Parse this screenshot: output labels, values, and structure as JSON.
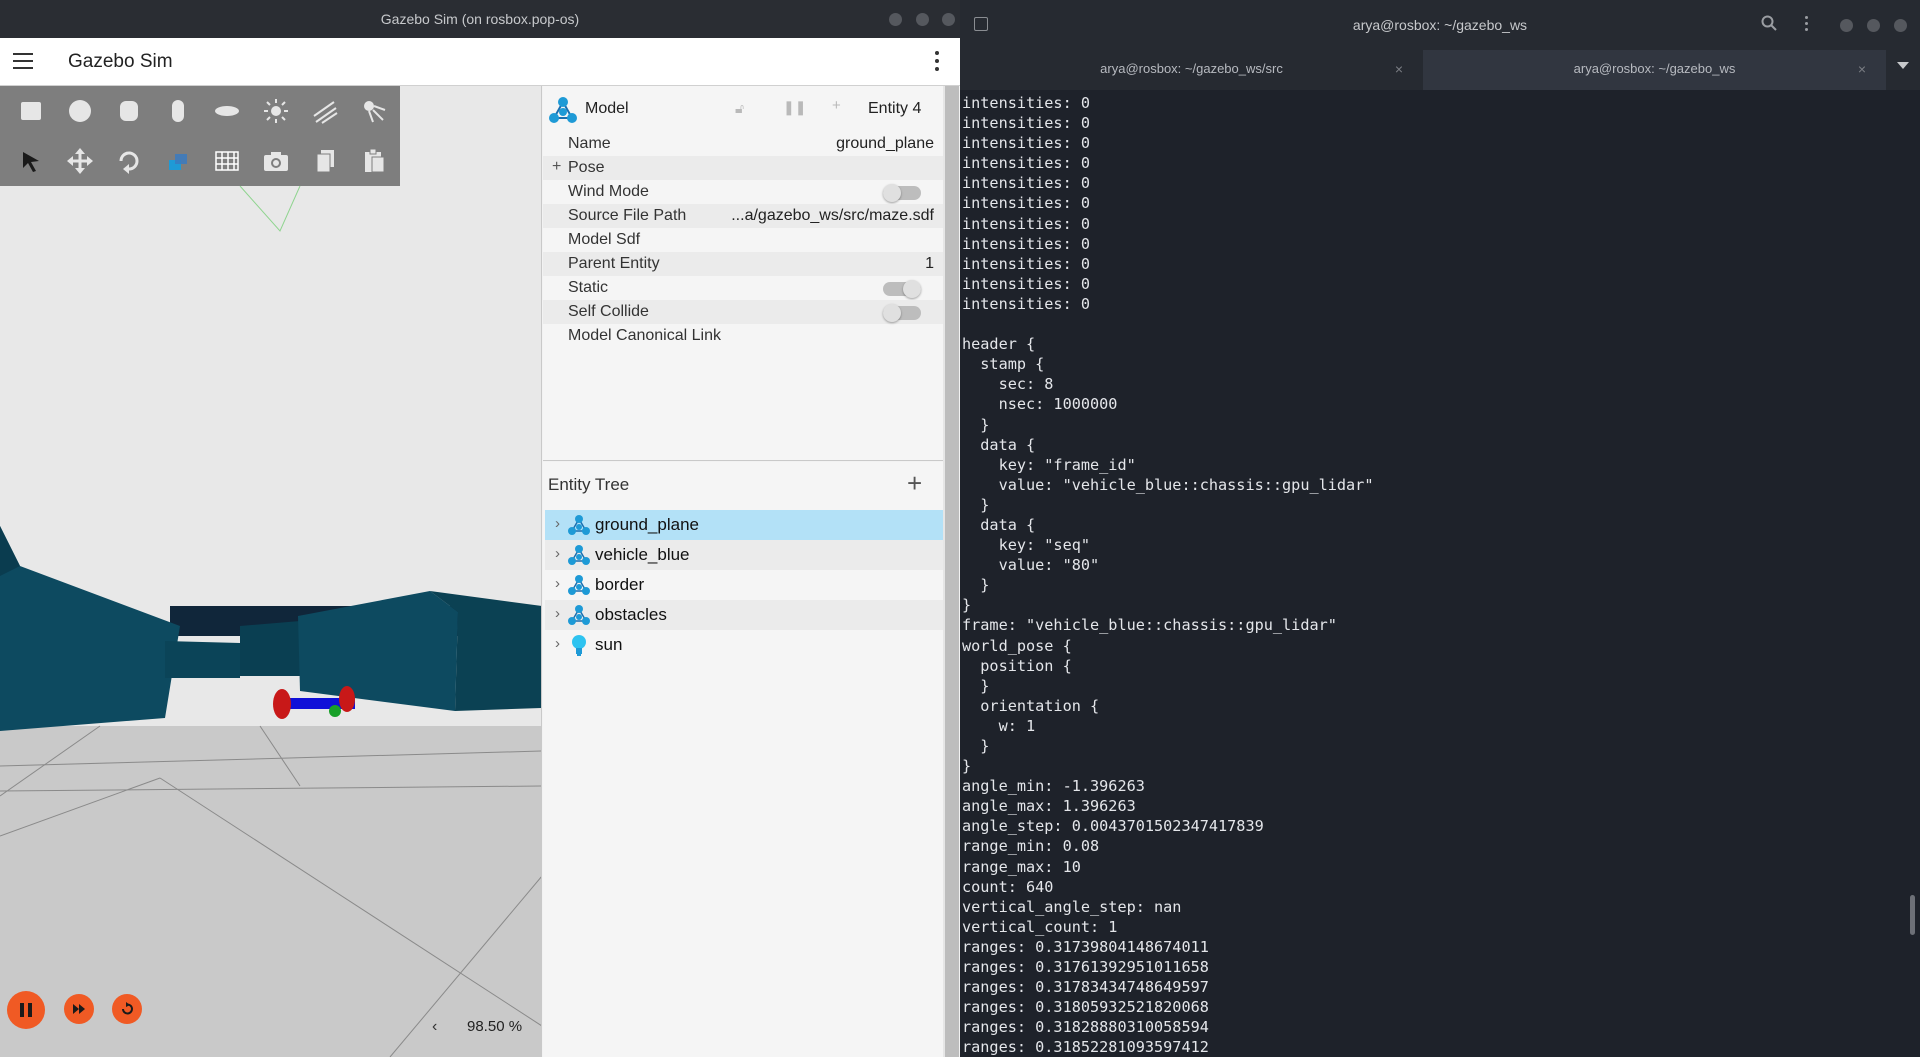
{
  "gazebo_window": {
    "os_title": "Gazebo Sim (on rosbox.pop-os)",
    "app_title": "Gazebo Sim",
    "real_time_factor": "98.50 %"
  },
  "component_inspector": {
    "title": "Model",
    "entity": "Entity 4",
    "properties": [
      {
        "label": "Name",
        "value": "ground_plane"
      },
      {
        "label": "Pose",
        "value": ""
      },
      {
        "label": "Wind Mode",
        "value": ""
      },
      {
        "label": "Source File Path",
        "value": "...a/gazebo_ws/src/maze.sdf"
      },
      {
        "label": "Model Sdf",
        "value": ""
      },
      {
        "label": "Parent Entity",
        "value": "1"
      },
      {
        "label": "Static",
        "value": ""
      },
      {
        "label": "Self Collide",
        "value": ""
      },
      {
        "label": "Model Canonical Link",
        "value": ""
      }
    ]
  },
  "entity_tree": {
    "title": "Entity Tree",
    "items": [
      {
        "label": "ground_plane",
        "icon": "model-icon"
      },
      {
        "label": "vehicle_blue",
        "icon": "model-icon"
      },
      {
        "label": "border",
        "icon": "model-icon"
      },
      {
        "label": "obstacles",
        "icon": "model-icon"
      },
      {
        "label": "sun",
        "icon": "light-bulb-icon"
      }
    ]
  },
  "terminal": {
    "window_title": "arya@rosbox: ~/gazebo_ws",
    "tabs": [
      {
        "label": "arya@rosbox: ~/gazebo_ws/src"
      },
      {
        "label": "arya@rosbox: ~/gazebo_ws"
      }
    ],
    "output": "intensities: 0\nintensities: 0\nintensities: 0\nintensities: 0\nintensities: 0\nintensities: 0\nintensities: 0\nintensities: 0\nintensities: 0\nintensities: 0\nintensities: 0\n\nheader {\n  stamp {\n    sec: 8\n    nsec: 1000000\n  }\n  data {\n    key: \"frame_id\"\n    value: \"vehicle_blue::chassis::gpu_lidar\"\n  }\n  data {\n    key: \"seq\"\n    value: \"80\"\n  }\n}\nframe: \"vehicle_blue::chassis::gpu_lidar\"\nworld_pose {\n  position {\n  }\n  orientation {\n    w: 1\n  }\n}\nangle_min: -1.396263\nangle_max: 1.396263\nangle_step: 0.0043701502347417839\nrange_min: 0.08\nrange_max: 10\ncount: 640\nvertical_angle_step: nan\nvertical_count: 1\nranges: 0.31739804148674011\nranges: 0.31761392951011658\nranges: 0.31783434748649597\nranges: 0.31805932521820068\nranges: 0.31828880310058594\nranges: 0.31852281093597412"
  },
  "colors": {
    "accent_orange": "#f05a24",
    "selection_blue": "#b3e1f7",
    "model_icon_blue": "#1e9ad6",
    "wall_teal": "#0e4a5e",
    "terminal_bg": "#1e222a"
  }
}
